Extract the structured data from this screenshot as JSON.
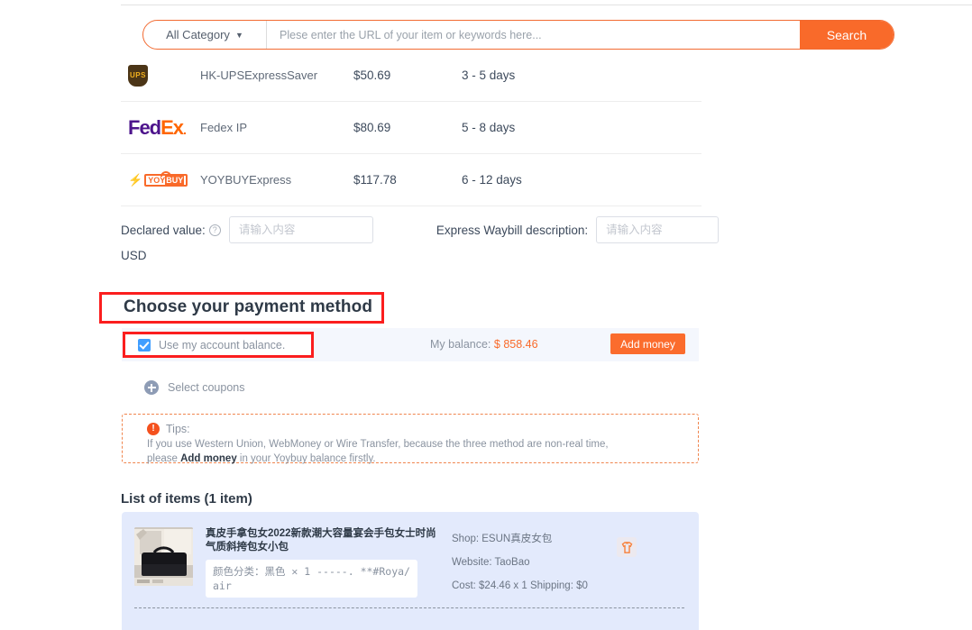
{
  "search": {
    "category_label": "All Category",
    "placeholder": "Plese enter the URL of your item or keywords here...",
    "value": "",
    "button_label": "Search"
  },
  "shipping": {
    "rows": [
      {
        "carrier_icon": "ups-logo",
        "carrier_text": "UPS",
        "name": "HK-UPSExpressSaver",
        "price": "$50.69",
        "days": "3 - 5 days"
      },
      {
        "carrier_icon": "fedex-logo",
        "carrier_text": "FedEx",
        "name": "Fedex IP",
        "price": "$80.69",
        "days": "5 - 8 days"
      },
      {
        "carrier_icon": "yoybuy-logo",
        "carrier_text": "YOYBUY",
        "name": "YOYBUYExpress",
        "price": "$117.78",
        "days": "6 - 12 days"
      }
    ]
  },
  "declared": {
    "label": "Declared value:",
    "help_icon": "question-mark-icon",
    "input_placeholder": "请输入内容",
    "input_value": "",
    "currency": "USD",
    "waybill_label": "Express Waybill description:",
    "waybill_placeholder": "请输入内容",
    "waybill_value": ""
  },
  "payment": {
    "heading": "Choose your payment method",
    "balance_checkbox_label": "Use my account balance.",
    "balance_checked": true,
    "my_balance_label": "My balance:",
    "my_balance_amount": "$ 858.46",
    "add_money_label": "Add money",
    "coupons_label": "Select coupons",
    "coupons_icon": "plus-circle-icon"
  },
  "tips": {
    "icon": "exclamation-icon",
    "title": "Tips:",
    "line1": "If you use Western Union, WebMoney or Wire Transfer, because the three method are non-real time,",
    "line2_pre": "please ",
    "line2_link": "Add money",
    "line2_post": " in your Yoybuy balance firstly."
  },
  "items": {
    "title": "List of items (1 item)",
    "list": [
      {
        "thumb_alt": "black-handbag-photo",
        "title": "真皮手拿包女2022新款潮大容量宴会手包女士时尚气质斜挎包女小包",
        "variant": "颜色分类：黑色 ✕  1 -----. **#Roya/air",
        "shop_label": "Shop: ESUN真皮女包",
        "website_label": "Website: TaoBao",
        "cost_label": "Cost: $24.46 x 1   Shipping: $0",
        "category_icon": "tshirt-icon"
      }
    ]
  },
  "colors": {
    "accent": "#f96a2a",
    "annotation": "#fb1e1e",
    "checkbox": "#409eff",
    "card_bg": "#e3eafc"
  }
}
